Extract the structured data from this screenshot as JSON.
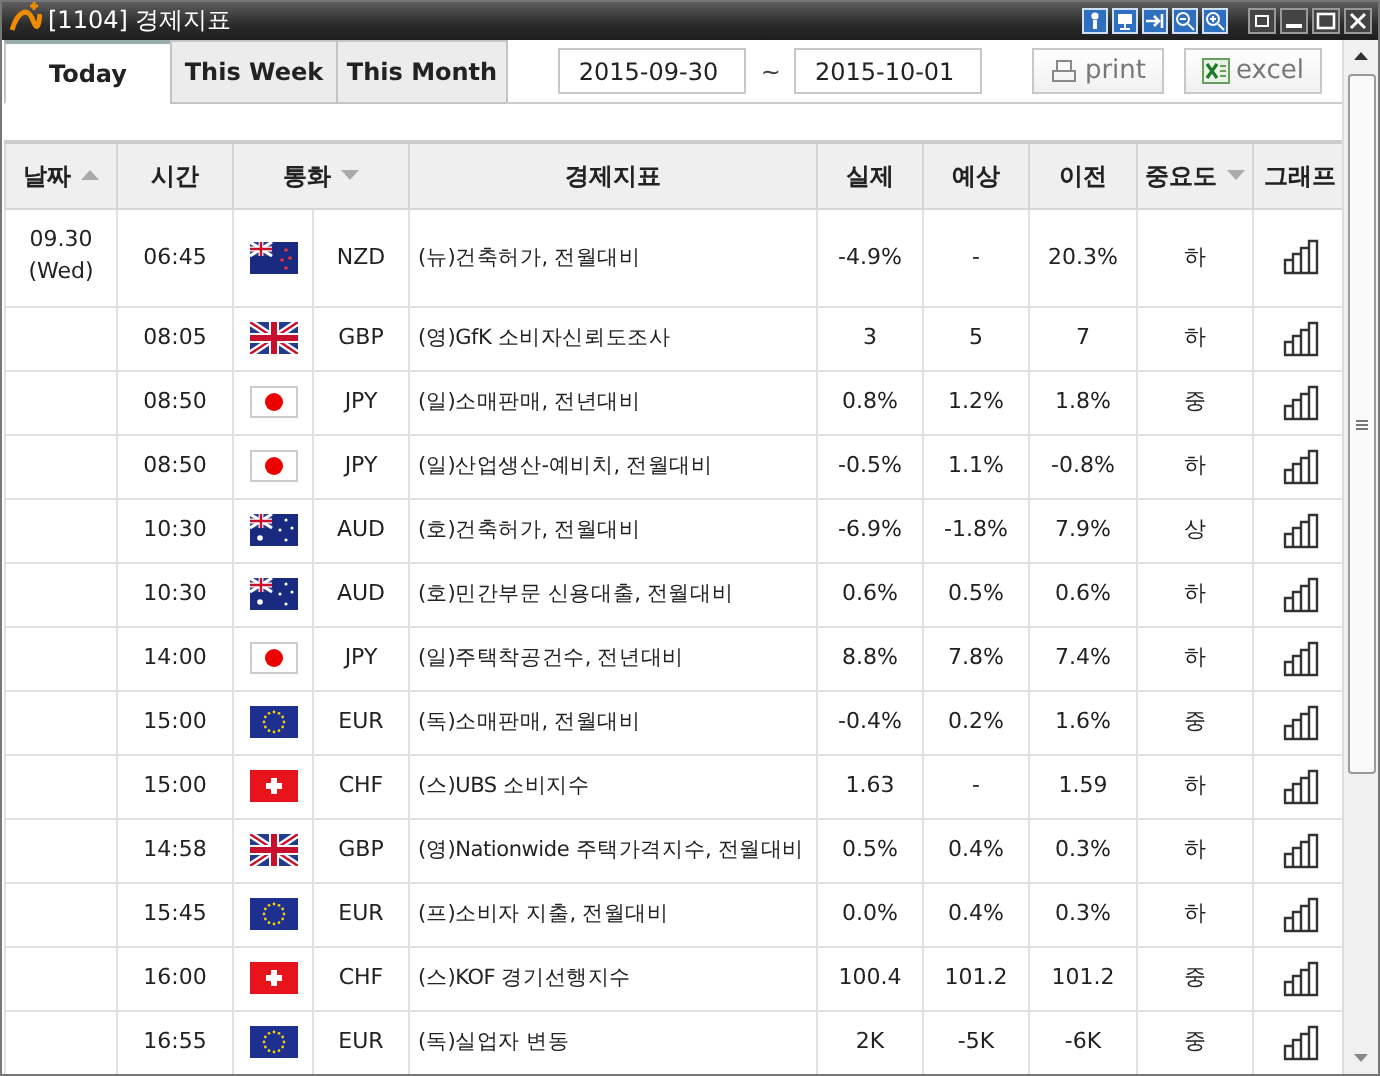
{
  "window": {
    "title": "[1104] 경제지표"
  },
  "tabs": [
    {
      "label": "Today",
      "selected": true
    },
    {
      "label": "This Week",
      "selected": false
    },
    {
      "label": "This Month",
      "selected": false
    }
  ],
  "date_range": {
    "from": "2015-09-30",
    "separator": "~",
    "to": "2015-10-01"
  },
  "buttons": [
    {
      "label": "print",
      "kind": "print"
    },
    {
      "label": "excel",
      "kind": "excel"
    }
  ],
  "table": {
    "columns": [
      {
        "label": "날짜",
        "kind": "sort-asc"
      },
      {
        "label": "시간",
        "kind": "plain"
      },
      {
        "label": "통화",
        "kind": "sort-desc"
      },
      {
        "label": "경제지표",
        "kind": "plain"
      },
      {
        "label": "실제",
        "kind": "plain"
      },
      {
        "label": "예상",
        "kind": "plain"
      },
      {
        "label": "이전",
        "kind": "plain"
      },
      {
        "label": "중요도",
        "kind": "sort-desc"
      },
      {
        "label": "그래프",
        "kind": "plain"
      }
    ],
    "date": {
      "day": "09.30",
      "weekday": "(Wed)"
    },
    "rows": [
      {
        "time": "06:45",
        "kind": "nz",
        "currency": "NZD",
        "indicator": "(뉴)건축허가, 전월대비",
        "actual": "-4.9%",
        "forecast": "-",
        "previous": "20.3%",
        "importance": "하"
      },
      {
        "time": "08:05",
        "kind": "gb",
        "currency": "GBP",
        "indicator": "(영)GfK 소비자신뢰도조사",
        "actual": "3",
        "forecast": "5",
        "previous": "7",
        "importance": "하"
      },
      {
        "time": "08:50",
        "kind": "jp",
        "currency": "JPY",
        "indicator": "(일)소매판매, 전년대비",
        "actual": "0.8%",
        "forecast": "1.2%",
        "previous": "1.8%",
        "importance": "중"
      },
      {
        "time": "08:50",
        "kind": "jp",
        "currency": "JPY",
        "indicator": "(일)산업생산-예비치, 전월대비",
        "actual": "-0.5%",
        "forecast": "1.1%",
        "previous": "-0.8%",
        "importance": "하"
      },
      {
        "time": "10:30",
        "kind": "au",
        "currency": "AUD",
        "indicator": "(호)건축허가, 전월대비",
        "actual": "-6.9%",
        "forecast": "-1.8%",
        "previous": "7.9%",
        "importance": "상"
      },
      {
        "time": "10:30",
        "kind": "au",
        "currency": "AUD",
        "indicator": "(호)민간부문 신용대출, 전월대비",
        "actual": "0.6%",
        "forecast": "0.5%",
        "previous": "0.6%",
        "importance": "하"
      },
      {
        "time": "14:00",
        "kind": "jp",
        "currency": "JPY",
        "indicator": "(일)주택착공건수, 전년대비",
        "actual": "8.8%",
        "forecast": "7.8%",
        "previous": "7.4%",
        "importance": "하"
      },
      {
        "time": "15:00",
        "kind": "eu",
        "currency": "EUR",
        "indicator": "(독)소매판매, 전월대비",
        "actual": "-0.4%",
        "forecast": "0.2%",
        "previous": "1.6%",
        "importance": "중"
      },
      {
        "time": "15:00",
        "kind": "ch",
        "currency": "CHF",
        "indicator": "(스)UBS 소비지수",
        "actual": "1.63",
        "forecast": "-",
        "previous": "1.59",
        "importance": "하"
      },
      {
        "time": "14:58",
        "kind": "gb",
        "currency": "GBP",
        "indicator": "(영)Nationwide 주택가격지수, 전월대비",
        "actual": "0.5%",
        "forecast": "0.4%",
        "previous": "0.3%",
        "importance": "하"
      },
      {
        "time": "15:45",
        "kind": "eu",
        "currency": "EUR",
        "indicator": "(프)소비자 지출, 전월대비",
        "actual": "0.0%",
        "forecast": "0.4%",
        "previous": "0.3%",
        "importance": "하"
      },
      {
        "time": "16:00",
        "kind": "ch",
        "currency": "CHF",
        "indicator": "(스)KOF 경기선행지수",
        "actual": "100.4",
        "forecast": "101.2",
        "previous": "101.2",
        "importance": "중"
      },
      {
        "time": "16:55",
        "kind": "eu",
        "currency": "EUR",
        "indicator": "(독)실업자 변동",
        "actual": "2K",
        "forecast": "-5K",
        "previous": "-6K",
        "importance": "중"
      }
    ]
  }
}
